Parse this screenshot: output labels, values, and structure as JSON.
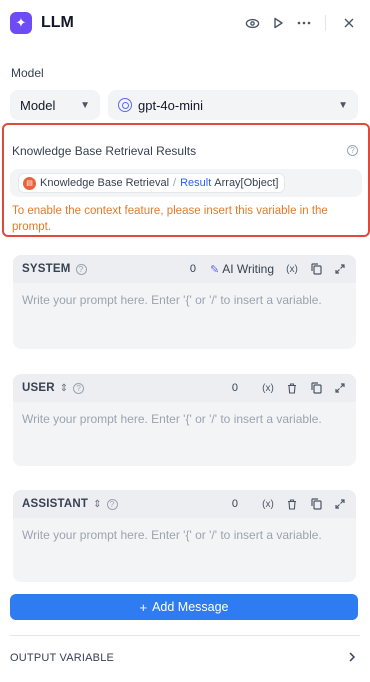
{
  "header": {
    "title": "LLM"
  },
  "model": {
    "section_label": "Model",
    "provider_select": "Model",
    "model_select": "gpt-4o-mini"
  },
  "context": {
    "title": "Knowledge Base Retrieval Results",
    "variable": {
      "node": "Knowledge Base Retrieval",
      "separator": "/",
      "name": "Result",
      "type": "Array[Object]"
    },
    "warning": "To enable the context feature, please insert this variable in the prompt."
  },
  "prompts": [
    {
      "role": "SYSTEM",
      "count": "0",
      "ai_writing": "AI Writing",
      "placeholder": "Write your prompt here. Enter '{' or '/' to insert a variable."
    },
    {
      "role": "USER",
      "count": "0",
      "placeholder": "Write your prompt here. Enter '{' or '/' to insert a variable."
    },
    {
      "role": "ASSISTANT",
      "count": "0",
      "placeholder": "Write your prompt here. Enter '{' or '/' to insert a variable."
    }
  ],
  "add_message": "Add Message",
  "output": {
    "label": "OUTPUT VARIABLE"
  },
  "colors": {
    "accent": "#2f7bf1",
    "highlight_border": "#e0483a",
    "warning": "#e07b2c"
  }
}
